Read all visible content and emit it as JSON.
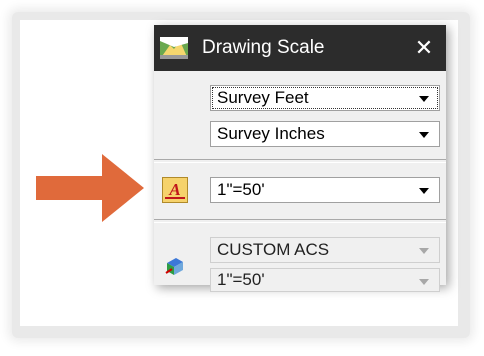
{
  "window": {
    "title": "Drawing Scale",
    "close_glyph": "✕"
  },
  "units": {
    "master": "Survey Feet",
    "sub": "Survey Inches"
  },
  "annotation_scale": {
    "value": "1\"=50'"
  },
  "acs": {
    "name": "CUSTOM ACS",
    "scale": "1\"=50'"
  },
  "colors": {
    "arrow": "#e06a3b",
    "titlebar": "#2c2c2c",
    "panel": "#f0f0f0"
  },
  "icons": {
    "title": "drawing-scale-icon",
    "annotation": "annotation-scale-icon",
    "acs": "acs-icon",
    "arrow": "arrow-right-icon"
  }
}
